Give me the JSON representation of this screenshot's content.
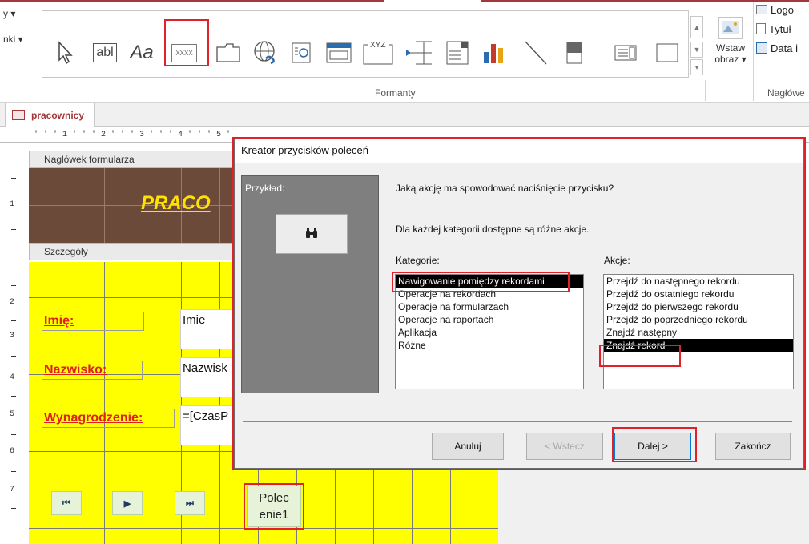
{
  "ribbon": {
    "left_items": [
      "y ▾",
      "nki ▾"
    ],
    "controls": [
      "select-pointer",
      "abl",
      "Aa",
      "xxxx",
      "frame",
      "web-browser",
      "navigation",
      "option-group",
      "XYZ",
      "page-break",
      "combo",
      "chart",
      "line",
      "toggle",
      "list",
      "rectangle"
    ],
    "xxxx_label": "XXXX",
    "xyz_label": "XYZ",
    "abl_label": "abl",
    "aa_label": "Aa",
    "insert_image": "Wstaw obraz ▾",
    "insert_image_line1": "Wstaw",
    "insert_image_line2": "obraz ▾",
    "group_label": "Formanty",
    "header_items": [
      "Logo",
      "Tytuł",
      "Data i"
    ],
    "header_group_label": "Nagłówe"
  },
  "tab": {
    "label": "pracownicy"
  },
  "ruler": {
    "text": "' ' ' 1 ' ' ' 2 ' ' ' 3 ' ' ' 4 ' ' ' 5 '"
  },
  "vruler": [
    "1",
    "2",
    "3",
    "4",
    "5",
    "6",
    "7"
  ],
  "form": {
    "header_section": "Nagłówek formularza",
    "title": "PRACO",
    "details_section": "Szczegóły",
    "labels": [
      "Imię:",
      "Nazwisko:",
      "Wynagrodzenie:"
    ],
    "fields": [
      "Imie",
      "Nazwisk",
      "=[CzasP"
    ],
    "nav_buttons": [
      "⏮",
      "▶",
      "⏭"
    ],
    "command_button": "Polecenie1",
    "command_button_line1": "Polec",
    "command_button_line2": "enie1"
  },
  "dialog": {
    "title": "Kreator przycisków poleceń",
    "sample_label": "Przykład:",
    "question": "Jaką akcję ma spowodować naciśnięcie przycisku?",
    "info": "Dla każdej kategorii dostępne są różne akcje.",
    "categories_label": "Kategorie:",
    "actions_label": "Akcje:",
    "categories": [
      "Nawigowanie pomiędzy rekordami",
      "Operacje na rekordach",
      "Operacje na formularzach",
      "Operacje na raportach",
      "Aplikacja",
      "Różne"
    ],
    "selected_category": 0,
    "actions": [
      "Przejdź do następnego rekordu",
      "Przejdź do ostatniego rekordu",
      "Przejdź do pierwszego rekordu",
      "Przejdź do poprzedniego rekordu",
      "Znajdź następny",
      "Znajdź rekord"
    ],
    "selected_action": 5,
    "buttons": {
      "cancel": "Anuluj",
      "back": "< Wstecz",
      "next": "Dalej >",
      "finish": "Zakończ"
    }
  },
  "colors": {
    "accent": "#a4373a",
    "highlight_red": "#e0202a",
    "form_bg": "#ffff00",
    "header_bg": "#6b4a3a",
    "title_yellow": "#ffe200",
    "label_red": "#e0201e"
  }
}
